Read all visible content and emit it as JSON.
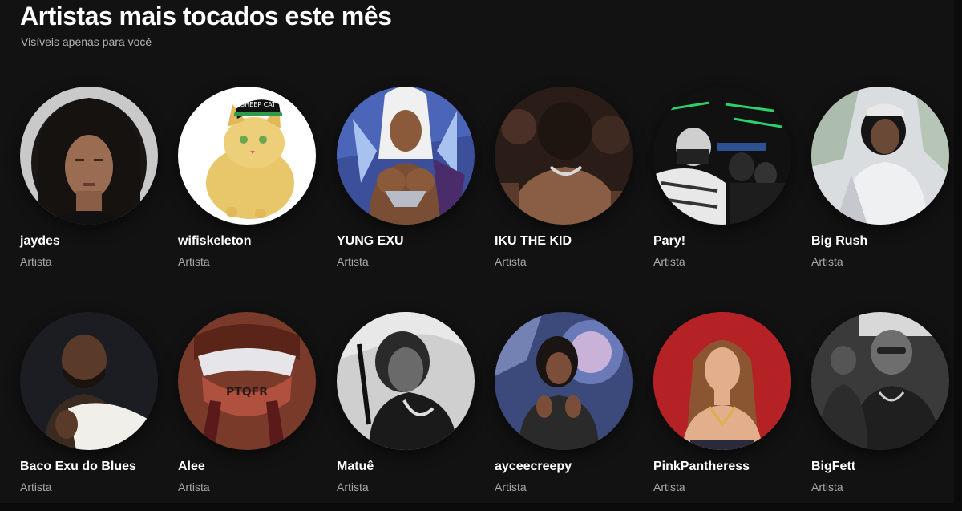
{
  "header": {
    "title": "Artistas mais tocados este mês",
    "subtitle": "Visíveis apenas para você"
  },
  "artists": [
    {
      "name": "jaydes",
      "kind": "Artista"
    },
    {
      "name": "wifiskeleton",
      "kind": "Artista"
    },
    {
      "name": "YUNG EXU",
      "kind": "Artista"
    },
    {
      "name": "IKU THE KID",
      "kind": "Artista"
    },
    {
      "name": "Pary!",
      "kind": "Artista"
    },
    {
      "name": "Big Rush",
      "kind": "Artista"
    },
    {
      "name": "Baco Exu do Blues",
      "kind": "Artista"
    },
    {
      "name": "Alee",
      "kind": "Artista"
    },
    {
      "name": "Matuê",
      "kind": "Artista"
    },
    {
      "name": "ayceecreepy",
      "kind": "Artista"
    },
    {
      "name": "PinkPantheress",
      "kind": "Artista"
    },
    {
      "name": "BigFett",
      "kind": "Artista"
    }
  ],
  "avatar_text": {
    "cat_hat": "SHEEP CAT",
    "grill": "PTQFR"
  },
  "colors": {
    "background": "#121212",
    "title": "#ffffff",
    "secondary_text": "#b3b3b3"
  }
}
